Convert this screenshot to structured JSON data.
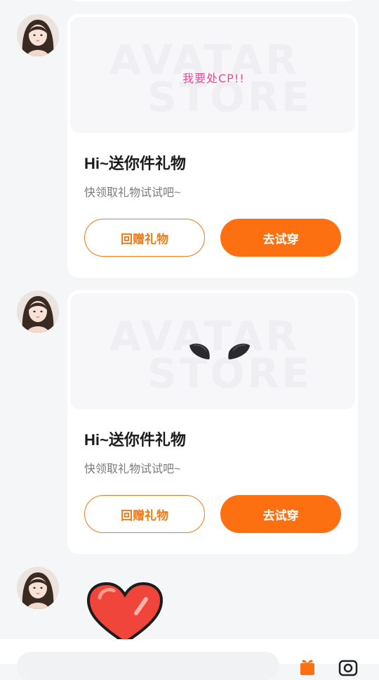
{
  "cards": [
    {
      "preview_watermark_line1": "AVATAR",
      "preview_watermark_line2": "STORE",
      "preview_text": "我要处CP!!",
      "title": "Hi~送你件礼物",
      "subtitle": "快领取礼物试试吧~",
      "return_gift_label": "回赠礼物",
      "try_on_label": "去试穿"
    },
    {
      "preview_watermark_line1": "AVATAR",
      "preview_watermark_line2": "STORE",
      "preview_item": "wings",
      "title": "Hi~送你件礼物",
      "subtitle": "快领取礼物试试吧~",
      "return_gift_label": "回赠礼物",
      "try_on_label": "去试穿"
    }
  ],
  "heart_message": {
    "icon": "heart-sticker-icon",
    "color": "#f0453a"
  },
  "colors": {
    "accent": "#fd7012",
    "background": "#f5f6f8",
    "pink_text": "#e84a8f"
  },
  "bottom_bar": {
    "icons": [
      "gift-icon",
      "camera-icon"
    ]
  }
}
